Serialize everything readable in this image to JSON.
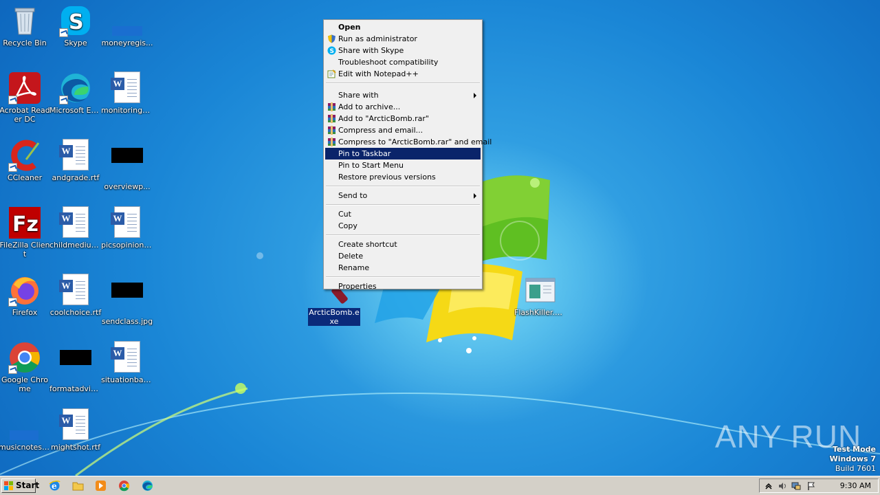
{
  "desktop_icons": [
    {
      "label": "Recycle Bin"
    },
    {
      "label": "Skype"
    },
    {
      "label": "moneyregis..."
    },
    {
      "label": "Acrobat Reader DC"
    },
    {
      "label": "Microsoft Edge"
    },
    {
      "label": "monitoringe..."
    },
    {
      "label": "CCleaner"
    },
    {
      "label": "andgrade.rtf"
    },
    {
      "label": "overviewp..."
    },
    {
      "label": "FileZilla Client"
    },
    {
      "label": "childmedium...."
    },
    {
      "label": "picsopinion.rtf"
    },
    {
      "label": "Firefox"
    },
    {
      "label": "coolchoice.rtf"
    },
    {
      "label": "sendclass.jpg"
    },
    {
      "label": "Google Chrome"
    },
    {
      "label": "formatadvic..."
    },
    {
      "label": "situationbad..."
    },
    {
      "label": "musicnotes...."
    },
    {
      "label": "mightshot.rtf"
    },
    {
      "label": "ArcticBomb.exe"
    },
    {
      "label": "FlashKiller.exe"
    }
  ],
  "context_menu": {
    "items": [
      {
        "label": "Open"
      },
      {
        "label": "Run as administrator",
        "icon": "uac-shield-icon"
      },
      {
        "label": "Share with Skype",
        "icon": "skype-icon"
      },
      {
        "label": "Troubleshoot compatibility"
      },
      {
        "label": "Edit with Notepad++",
        "icon": "notepadpp-icon"
      },
      {
        "label": "Share with"
      },
      {
        "label": "Add to archive...",
        "icon": "winrar-icon"
      },
      {
        "label": "Add to \"ArcticBomb.rar\"",
        "icon": "winrar-icon"
      },
      {
        "label": "Compress and email...",
        "icon": "winrar-icon"
      },
      {
        "label": "Compress to \"ArcticBomb.rar\" and email",
        "icon": "winrar-icon"
      },
      {
        "label": "Pin to Taskbar"
      },
      {
        "label": "Pin to Start Menu"
      },
      {
        "label": "Restore previous versions"
      },
      {
        "label": "Send to"
      },
      {
        "label": "Cut"
      },
      {
        "label": "Copy"
      },
      {
        "label": "Create shortcut"
      },
      {
        "label": "Delete"
      },
      {
        "label": "Rename"
      },
      {
        "label": "Properties"
      }
    ],
    "highlighted": "Pin to Taskbar"
  },
  "taskbar": {
    "start_label": "Start",
    "pinned": [
      "internet-explorer-icon",
      "explorer-folder-icon",
      "media-player-icon",
      "chrome-icon",
      "edge-icon"
    ],
    "clock": "9:30 AM"
  },
  "watermark": {
    "brand": "ANY RUN",
    "line1": "Test Mode",
    "line2": "Windows 7",
    "line3": "Build 7601"
  },
  "colors": {
    "menu_highlight": "#0a246a",
    "desktop_blue": "#1a86d6",
    "taskbar": "#d4d0c8"
  }
}
